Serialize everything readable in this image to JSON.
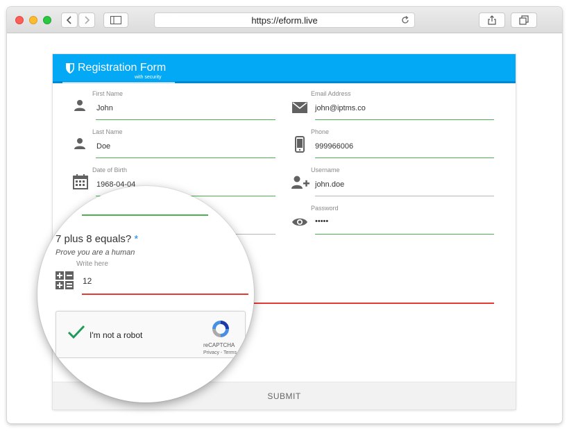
{
  "browser": {
    "url": "https://eform.live"
  },
  "form": {
    "title": "Registration Form",
    "subtitle": "with security",
    "fields": {
      "first_name": {
        "label": "First Name",
        "value": "John"
      },
      "last_name": {
        "label": "Last Name",
        "value": "Doe"
      },
      "dob": {
        "label": "Date of Birth",
        "value": "1968-04-04"
      },
      "email": {
        "label": "Email Address",
        "value": "john@iptms.co"
      },
      "phone": {
        "label": "Phone",
        "value": "999966006"
      },
      "username": {
        "label": "Username",
        "value": "john.doe"
      },
      "password": {
        "label": "Password",
        "value": "•••••"
      }
    },
    "submit_label": "SUBMIT"
  },
  "captcha": {
    "question": "7 plus 8 equals?",
    "required_mark": "*",
    "hint": "Prove you are a human",
    "input_label": "Write here",
    "input_value": "12",
    "recaptcha_text": "I'm not a robot",
    "recaptcha_brand": "reCAPTCHA",
    "recaptcha_terms": "Privacy - Terms"
  },
  "colors": {
    "header": "#03a9f4",
    "valid": "#4caf50",
    "invalid": "#e53935",
    "icon": "#616161"
  }
}
